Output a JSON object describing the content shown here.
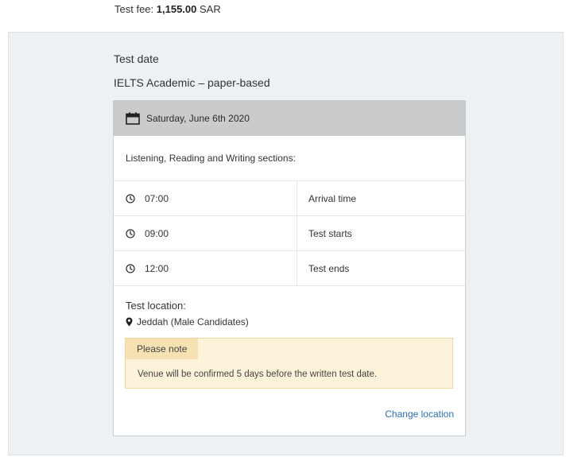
{
  "fee": {
    "label": "Test fee:",
    "amount": "1,155.00",
    "currency": "SAR"
  },
  "section_title": "Test date",
  "test_type": "IELTS Academic – paper-based",
  "card": {
    "date": "Saturday, June 6th 2020",
    "sections_label": "Listening, Reading and Writing sections:",
    "schedule": [
      {
        "time": "07:00",
        "label": "Arrival time"
      },
      {
        "time": "09:00",
        "label": "Test starts"
      },
      {
        "time": "12:00",
        "label": "Test ends"
      }
    ],
    "location_title": "Test location:",
    "location_value": "Jeddah (Male Candidates)",
    "note": {
      "title": "Please note",
      "text": "Venue will be confirmed 5 days before the written test date."
    },
    "change_location_label": "Change location"
  },
  "colors": {
    "panel_bg": "#eef1f3",
    "header_bg": "#c9cbcd",
    "note_bg": "#fdf3da",
    "note_tab_bg": "#f6e1b3",
    "link": "#2a6fb6"
  },
  "icons": {
    "date": "calendar-icon",
    "time": "clock-icon",
    "location": "map-pin-icon"
  }
}
